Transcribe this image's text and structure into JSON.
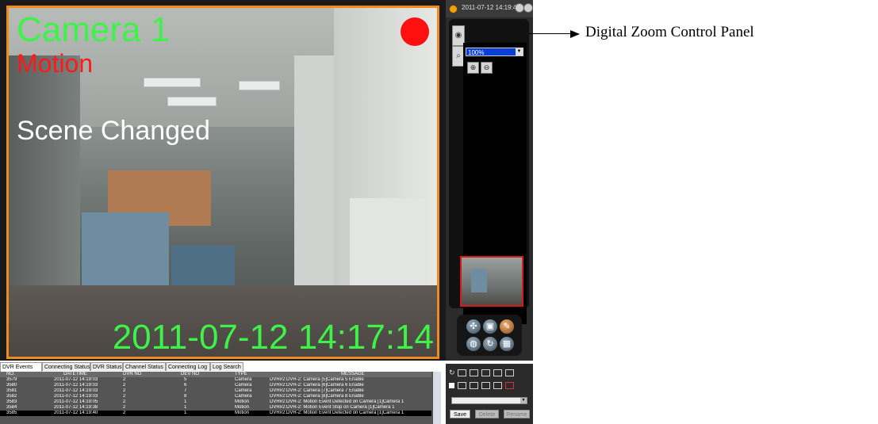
{
  "camera": {
    "title": "Camera 1",
    "event": "Motion",
    "scene_alert": "Scene Changed",
    "timestamp": "2011-07-12 14:17:14",
    "border_color": "#f08a1c",
    "recording_indicator": "red-dot"
  },
  "panel": {
    "clock": "2011-07-12 14:19:45",
    "zoom_value": "100%",
    "zoom_in_icon": "zoom-in-icon",
    "zoom_out_icon": "zoom-out-icon"
  },
  "tabs": [
    "DVR Events",
    "Connecting Status",
    "DVR Status",
    "Channel Status",
    "Connecting Log",
    "Log Search"
  ],
  "log": {
    "columns": [
      "NO.",
      "DATETIME",
      "DVR NO",
      "DEV NO",
      "TYPE",
      "MESSAGE"
    ],
    "rows": [
      [
        "3579",
        "2011-07-12 14:19:03",
        "2",
        "5",
        "Camera",
        "DVR#2:DVR-2: Camera [5]Camera 5 Enable"
      ],
      [
        "3580",
        "2011-07-12 14:19:03",
        "2",
        "6",
        "Camera",
        "DVR#2:DVR-2: Camera [6]Camera 6 Enable"
      ],
      [
        "3581",
        "2011-07-12 14:19:03",
        "2",
        "7",
        "Camera",
        "DVR#2:DVR-2: Camera [7]Camera 7 Enable"
      ],
      [
        "3582",
        "2011-07-12 14:19:03",
        "2",
        "8",
        "Camera",
        "DVR#2:DVR-2: Camera [8]Camera 8 Enable"
      ],
      [
        "3583",
        "2011-07-12 14:19:05",
        "2",
        "1",
        "Motion",
        "DVR#2:DVR-2: Motion Event Detected on Camera [1]Camera 1"
      ],
      [
        "3584",
        "2011-07-12 14:19:38",
        "2",
        "1",
        "Motion",
        "DVR#2:DVR-2: Motion Event Stop on Camera [1]Camera 1"
      ],
      [
        "3585",
        "2011-07-12 14:19:40",
        "2",
        "1",
        "Motion",
        "DVR#2:DVR-2: Motion Event Detected on Camera [1]Camera 1"
      ]
    ],
    "selected_row": 6
  },
  "buttons": {
    "save": "Save",
    "delete": "Delete",
    "rename": "Rename"
  },
  "annotation": "Digital Zoom Control Panel"
}
